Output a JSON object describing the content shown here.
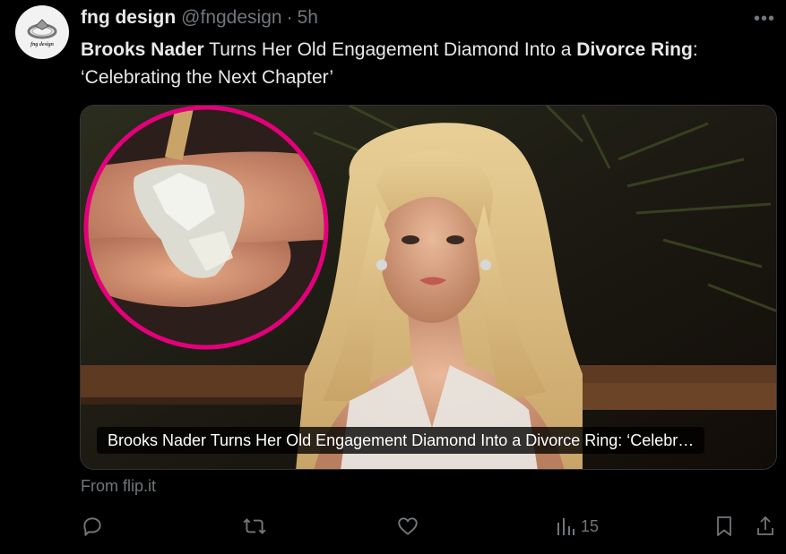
{
  "author": {
    "display_name": "fng design",
    "handle": "@fngdesign",
    "separator": "·",
    "time": "5h",
    "avatar_text": "fng design",
    "avatar_icon": "ring-logo-icon"
  },
  "more_label": "•••",
  "tweet": {
    "part1_bold": "Brooks Nader",
    "part2": " Turns Her Old Engagement Diamond Into a ",
    "part3_bold": "Divorce Ring",
    "part4": ":",
    "line2": "‘Celebrating the Next Chapter’"
  },
  "card": {
    "title": "Brooks Nader Turns Her Old Engagement Diamond Into a Divorce Ring: ‘Celebr…",
    "inset_border_color": "#e3007a"
  },
  "source": "From flip.it",
  "actions": {
    "reply_icon": "reply-icon",
    "repost_icon": "repost-icon",
    "like_icon": "heart-icon",
    "views_icon": "views-bar-icon",
    "views_count": "15",
    "bookmark_icon": "bookmark-icon",
    "share_icon": "share-icon"
  },
  "colors": {
    "background": "#000000",
    "text": "#e7e9ea",
    "muted": "#71767b"
  }
}
